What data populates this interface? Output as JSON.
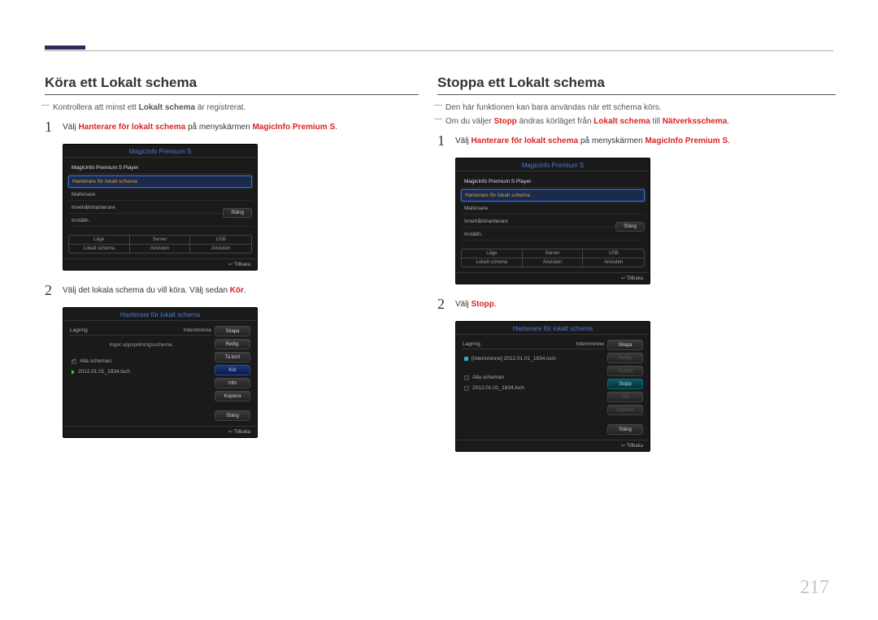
{
  "page_number": "217",
  "left": {
    "heading": "Köra ett Lokalt schema",
    "note_prefix": "Kontrollera att minst ett ",
    "note_bold": "Lokalt schema",
    "note_suffix": " är registrerat.",
    "step1_prefix": "Välj ",
    "step1_red1": "Hanterare för lokalt schema",
    "step1_mid": " på menyskärmen ",
    "step1_red2": "MagicInfo Premium S",
    "step1_suffix": ".",
    "step2_prefix": "Välj det lokala schema du vill köra. Välj sedan ",
    "step2_red": "Kör",
    "step2_suffix": "."
  },
  "right": {
    "heading": "Stoppa ett Lokalt schema",
    "note1": "Den här funktionen kan bara användas när ett schema körs.",
    "note2_prefix": "Om du väljer ",
    "note2_red1": "Stopp",
    "note2_mid1": " ändras körläget från ",
    "note2_red2": "Lokalt schema",
    "note2_mid2": " till ",
    "note2_red3": "Nätverksschema",
    "note2_suffix": ".",
    "step1_prefix": "Välj ",
    "step1_red1": "Hanterare för lokalt schema",
    "step1_mid": " på menyskärmen ",
    "step1_red2": "MagicInfo Premium S",
    "step1_suffix": ".",
    "step2_prefix": "Välj ",
    "step2_red": "Stopp",
    "step2_suffix": "."
  },
  "shot_menu": {
    "title": "MagicInfo Premium S",
    "line1": "MagicInfo Premium S Player",
    "line2": "Hanterare för lokalt schema",
    "line3": "Mallvisare",
    "line4": "Innehållshanterare",
    "line5": "Inställn.",
    "close": "Stäng",
    "status": {
      "h1": "Läge",
      "h2": "Server",
      "h3": "USB",
      "v1": "Lokalt schema",
      "v2": "Ansluten",
      "v3": "Ansluten"
    },
    "back": "Tillbaka"
  },
  "shot_sched_run": {
    "title": "Hanterare för lokalt schema",
    "storage": "Lagring",
    "storage_val": "Internminne",
    "msg": "Inget uppspelningsschema",
    "all": "Alla scheman",
    "file": "2012.01.01_1834.lsch",
    "btns": {
      "b1": "Skapa",
      "b2": "Redig.",
      "b3": "Ta bort",
      "b4": "Kör",
      "b5": "Info",
      "b6": "Kopiera",
      "b7": "Stäng"
    },
    "back": "Tillbaka"
  },
  "shot_sched_stop": {
    "title": "Hanterare för lokalt schema",
    "storage": "Lagring",
    "storage_val": "Internminne",
    "running": "[Internminne] 2012.01.01_1834.lsch",
    "all": "Alla scheman",
    "file": "2012.01.01_1834.lsch",
    "btns": {
      "b1": "Skapa",
      "b2": "Redig.",
      "b3": "Ta bort",
      "b4": "Stopp",
      "b5": "Info",
      "b6": "Kopiera",
      "b7": "Stäng"
    },
    "back": "Tillbaka"
  }
}
